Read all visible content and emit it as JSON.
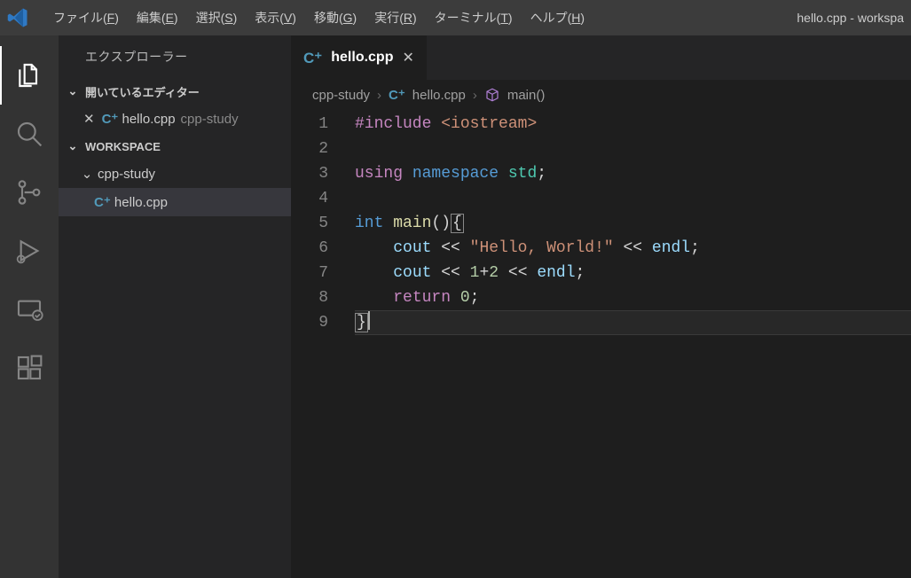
{
  "menu": {
    "file": "ファイル(",
    "file_u": "F",
    "file2": ")",
    "edit": "編集(",
    "edit_u": "E",
    "edit2": ")",
    "select": "選択(",
    "select_u": "S",
    "select2": ")",
    "view": "表示(",
    "view_u": "V",
    "view2": ")",
    "go": "移動(",
    "go_u": "G",
    "go2": ")",
    "run": "実行(",
    "run_u": "R",
    "run2": ")",
    "terminal": "ターミナル(",
    "terminal_u": "T",
    "terminal2": ")",
    "help": "ヘルプ(",
    "help_u": "H",
    "help2": ")"
  },
  "window_title": "hello.cpp - workspa",
  "explorer": {
    "title": "エクスプローラー",
    "open_editors_hdr": "開いているエディター",
    "workspace_hdr": "WORKSPACE",
    "open_editor": {
      "filename": "hello.cpp",
      "descr": "cpp-study"
    },
    "folder": "cpp-study",
    "file": "hello.cpp"
  },
  "tab": {
    "filename": "hello.cpp"
  },
  "breadcrumbs": {
    "p1": "cpp-study",
    "p2": "hello.cpp",
    "p3": "main()"
  },
  "code": {
    "l1_include": "#include",
    "l1_header": " <iostream>",
    "l3_using": "using",
    "l3_namespace": " namespace",
    "l3_std": " std",
    "l3_sc": ";",
    "l5_int": "int",
    "l5_main": " main",
    "l5_paren": "()",
    "l5_brace": "{",
    "l6_indent": "    ",
    "l6_cout": "cout",
    "l6_op1": " << ",
    "l6_str": "\"Hello, World!\"",
    "l6_op2": " << ",
    "l6_endl": "endl",
    "l6_sc": ";",
    "l7_indent": "    ",
    "l7_cout": "cout",
    "l7_op1": " << ",
    "l7_expr_1": "1",
    "l7_plus": "+",
    "l7_expr_2": "2",
    "l7_op2": " << ",
    "l7_endl": "endl",
    "l7_sc": ";",
    "l8_indent": "    ",
    "l8_return": "return",
    "l8_sp": " ",
    "l8_zero": "0",
    "l8_sc": ";",
    "l9_brace": "}"
  },
  "linenumbers": [
    "1",
    "2",
    "3",
    "4",
    "5",
    "6",
    "7",
    "8",
    "9"
  ],
  "icons": {
    "cpp": "C⁺",
    "close": "✕",
    "chevdown": "⌄",
    "chevright": "›"
  }
}
